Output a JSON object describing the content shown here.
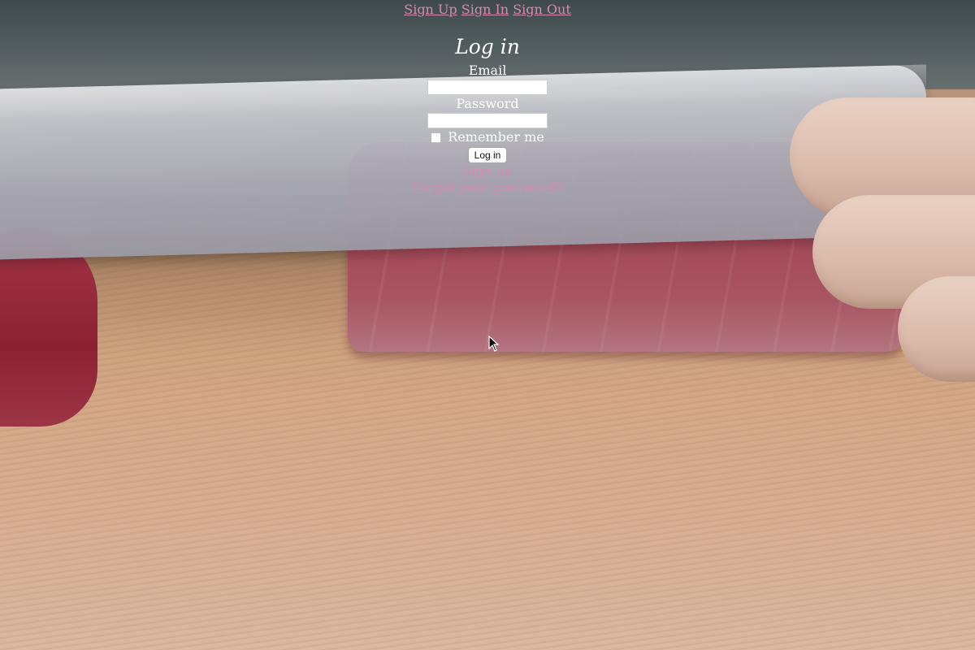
{
  "nav": {
    "links": [
      "Sign Up",
      "Sign In",
      "Sign Out"
    ]
  },
  "form": {
    "title": "Log in",
    "email_label": "Email",
    "password_label": "Password",
    "remember_label": "Remember me",
    "submit_label": "Log in",
    "signup_link": "Sign up",
    "forgot_link": "Forgot your password?"
  },
  "colors": {
    "link": "#d58bb0",
    "text": "#ffffff"
  },
  "background": {
    "icon": "sashimi-photo"
  }
}
